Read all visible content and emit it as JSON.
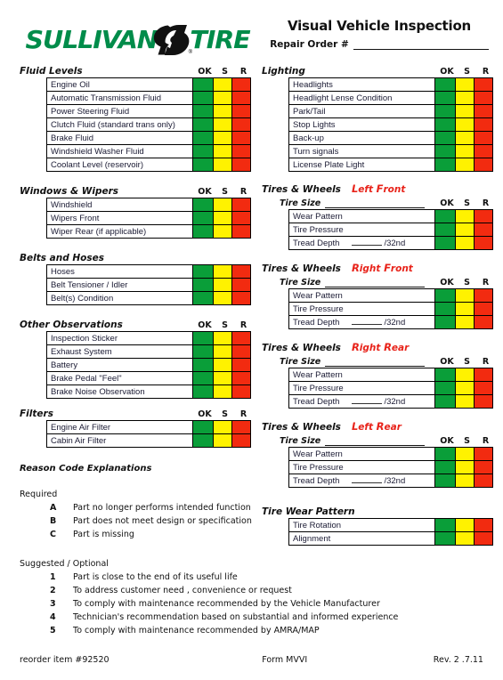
{
  "header": {
    "logo": {
      "word1": "SULLIVAN",
      "word2": "TIRE",
      "swoosh_icon": "tire-swoosh-icon",
      "registered_mark": "®"
    },
    "title": "Visual Vehicle Inspection",
    "repair_order_label": "Repair Order #"
  },
  "colors": {
    "brand_green": "#008C4A",
    "ok_green": "#0A9E39",
    "s_yellow": "#FFF200",
    "r_red": "#F22B10",
    "position_red": "#E8231A"
  },
  "columns": {
    "ok": "OK",
    "s": "S",
    "r": "R"
  },
  "sections": {
    "fluid_levels": {
      "title": "Fluid Levels",
      "show_col_headers": true,
      "rows": [
        "Engine Oil",
        "Automatic Transmission Fluid",
        "Power Steering Fluid",
        "Clutch Fluid (standard trans only)",
        "Brake Fluid",
        "Windshield Washer Fluid",
        "Coolant Level (reservoir)"
      ]
    },
    "windows_wipers": {
      "title": "Windows & Wipers",
      "show_col_headers": true,
      "rows": [
        "Windshield",
        "Wipers Front",
        "Wiper Rear (if applicable)"
      ]
    },
    "belts_hoses": {
      "title": "Belts and Hoses",
      "show_col_headers": false,
      "rows": [
        "Hoses",
        "Belt  Tensioner / Idler",
        "Belt(s) Condition"
      ]
    },
    "other_observations": {
      "title": "Other Observations",
      "show_col_headers": true,
      "rows": [
        "Inspection Sticker",
        "Exhaust System",
        "Battery",
        "Brake Pedal \"Feel\"",
        "Brake Noise Observation"
      ]
    },
    "filters": {
      "title": "Filters",
      "show_col_headers": true,
      "rows": [
        "Engine Air Filter",
        "Cabin Air Filter"
      ]
    },
    "lighting": {
      "title": "Lighting",
      "show_col_headers": true,
      "rows": [
        "Headlights",
        "Headlight Lense Condition",
        "Park/Tail",
        "Stop Lights",
        "Back-up",
        "Turn signals",
        "License Plate Light"
      ]
    },
    "tire_wear_pattern": {
      "title": "Tire Wear Pattern",
      "show_col_headers": false,
      "rows": [
        "Tire Rotation",
        "Alignment"
      ]
    }
  },
  "tire_blocks": [
    {
      "title": "Tires & Wheels",
      "position_cap1": "L",
      "position_rest1": "eft",
      "position_cap2": "F",
      "position_rest2": "ront",
      "tire_size_label": "Tire Size",
      "rows": [
        "Wear Pattern",
        "Tire Pressure"
      ],
      "tread_label": "Tread Depth",
      "tread_unit": "/32nd"
    },
    {
      "title": "Tires & Wheels",
      "position_cap1": "R",
      "position_rest1": "ight",
      "position_cap2": "F",
      "position_rest2": "ront",
      "tire_size_label": "Tire Size",
      "rows": [
        "Wear Pattern",
        "Tire Pressure"
      ],
      "tread_label": "Tread Depth",
      "tread_unit": "/32nd"
    },
    {
      "title": "Tires & Wheels",
      "position_cap1": "R",
      "position_rest1": "ight",
      "position_cap2": "R",
      "position_rest2": "ear",
      "tire_size_label": "Tire Size",
      "rows": [
        "Wear Pattern",
        "Tire Pressure"
      ],
      "tread_label": "Tread Depth",
      "tread_unit": "/32nd"
    },
    {
      "title": "Tires & Wheels",
      "position_cap1": "L",
      "position_rest1": "eft",
      "position_cap2": "R",
      "position_rest2": "ear",
      "tire_size_label": "Tire Size",
      "rows": [
        "Wear Pattern",
        "Tire Pressure"
      ],
      "tread_label": "Tread Depth",
      "tread_unit": "/32nd"
    }
  ],
  "reason_codes": {
    "title": "Reason Code Explanations",
    "required_label": "Required",
    "required_items": [
      {
        "key": "A",
        "text": "Part no longer performs intended function"
      },
      {
        "key": "B",
        "text": "Part does not meet design or specification"
      },
      {
        "key": "C",
        "text": "Part is missing"
      }
    ],
    "suggested_label": "Suggested / Optional",
    "suggested_items": [
      {
        "key": "1",
        "text": "Part is close to the end of its useful life"
      },
      {
        "key": "2",
        "text": "To address customer need , convenience  or request"
      },
      {
        "key": "3",
        "text": "To comply with maintenance recommended by the Vehicle Manufacturer"
      },
      {
        "key": "4",
        "text": "Technician's recommendation based on substantial and informed experience"
      },
      {
        "key": "5",
        "text": "To comply with maintenance recommended by AMRA/MAP"
      }
    ]
  },
  "footer": {
    "reorder": "reorder item #92520",
    "form": "Form MVVI",
    "revision": "Rev. 2 .7.11"
  }
}
